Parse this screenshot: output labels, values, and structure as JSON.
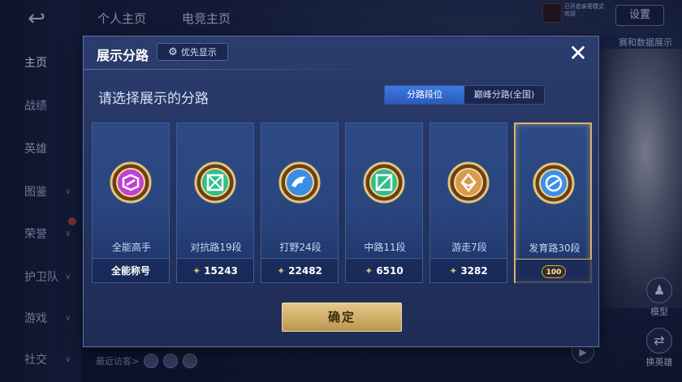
{
  "background": {
    "back_icon": "↩",
    "sidebar": [
      {
        "label": "主页",
        "active": true,
        "chevron": false
      },
      {
        "label": "战绩",
        "active": false,
        "chevron": false
      },
      {
        "label": "英雄",
        "active": false,
        "chevron": false
      },
      {
        "label": "图鉴",
        "active": false,
        "chevron": true
      },
      {
        "label": "荣誉",
        "active": false,
        "chevron": true
      },
      {
        "label": "护卫队",
        "active": false,
        "chevron": true
      },
      {
        "label": "游戏",
        "active": false,
        "chevron": true
      },
      {
        "label": "社交",
        "active": false,
        "chevron": true
      }
    ],
    "tabs": [
      "个人主页",
      "电竞主页"
    ],
    "top_note": "已开启亲密模式 欢迎",
    "settings_label": "设置",
    "data_button": "赛和数据展示",
    "right_buttons": [
      {
        "label": "模型",
        "icon": "figure-icon"
      },
      {
        "label": "换英雄",
        "icon": "swap-icon"
      }
    ],
    "visitors_label": "最近访客>"
  },
  "modal": {
    "title": "展示分路",
    "priority_label": "优先显示",
    "close_icon": "✕",
    "subtitle": "请选择展示的分路",
    "segments": [
      {
        "label": "分路段位",
        "active": true
      },
      {
        "label": "巅峰分路(全国)",
        "active": false
      }
    ],
    "cards": [
      {
        "rank": "全能高手",
        "bottom": "全能称号",
        "points": null,
        "selected": false,
        "color": "#c23fd6",
        "medal": "all-round-medal-icon"
      },
      {
        "rank": "对抗路19段",
        "bottom": null,
        "points": "15243",
        "selected": false,
        "color": "#2fbf8a",
        "medal": "clash-lane-medal-icon"
      },
      {
        "rank": "打野24段",
        "bottom": null,
        "points": "22482",
        "selected": false,
        "color": "#3a8de6",
        "medal": "jungle-medal-icon"
      },
      {
        "rank": "中路11段",
        "bottom": null,
        "points": "6510",
        "selected": false,
        "color": "#2fbf8a",
        "medal": "mid-lane-medal-icon"
      },
      {
        "rank": "游走7段",
        "bottom": null,
        "points": "3282",
        "selected": false,
        "color": "#d99a4b",
        "medal": "roam-medal-icon"
      },
      {
        "rank": "发育路30段",
        "bottom": null,
        "points": null,
        "badge": "100",
        "selected": true,
        "color": "#3c8fe8",
        "medal": "farm-lane-medal-icon"
      }
    ],
    "confirm_label": "确定"
  }
}
